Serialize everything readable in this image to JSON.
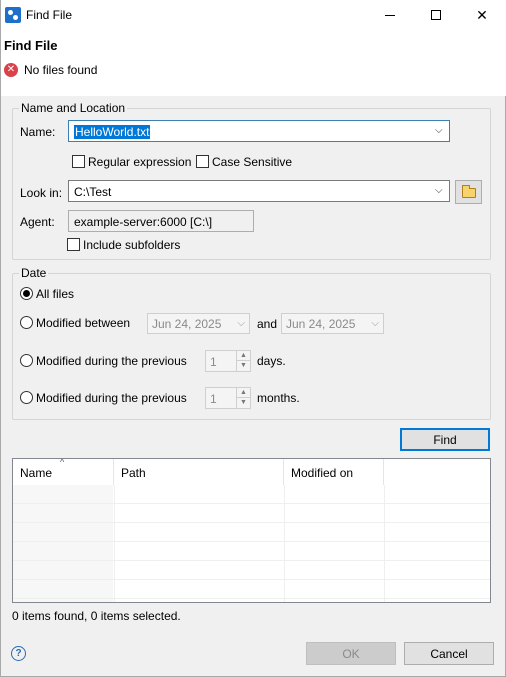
{
  "window": {
    "title": "Find File",
    "icon": "find-file-app-icon",
    "controls": {
      "minimize": "minimize-icon",
      "maximize": "maximize-icon",
      "close": "✕"
    }
  },
  "header": {
    "title": "Find File",
    "message": "No files found",
    "message_icon": "error-icon"
  },
  "name_location": {
    "legend": "Name and Location",
    "name_label": "Name:",
    "name_value": "HelloWorld.txt",
    "regex_label": "Regular expression",
    "regex_checked": false,
    "case_label": "Case Sensitive",
    "case_checked": false,
    "lookin_label": "Look in:",
    "lookin_value": "C:\\Test",
    "agent_label": "Agent:",
    "agent_value": "example-server:6000 [C:\\]",
    "subfolders_label": "Include subfolders",
    "subfolders_checked": false
  },
  "date": {
    "legend": "Date",
    "all_files_label": "All files",
    "selected_option": "all_files",
    "between_label": "Modified between",
    "between_from": "Jun 24, 2025",
    "and_label": "and",
    "between_to": "Jun 24, 2025",
    "prev_days_label": "Modified during the previous",
    "prev_days_value": "1",
    "days_label": "days.",
    "prev_months_label": "Modified during the previous",
    "prev_months_value": "1",
    "months_label": "months."
  },
  "find_button": "Find",
  "results": {
    "columns": [
      "Name",
      "Path",
      "Modified on"
    ],
    "sort_column": "Name",
    "rows": []
  },
  "status_text": "0 items found, 0 items selected.",
  "footer": {
    "help_icon": "?",
    "ok_label": "OK",
    "ok_enabled": false,
    "cancel_label": "Cancel"
  }
}
